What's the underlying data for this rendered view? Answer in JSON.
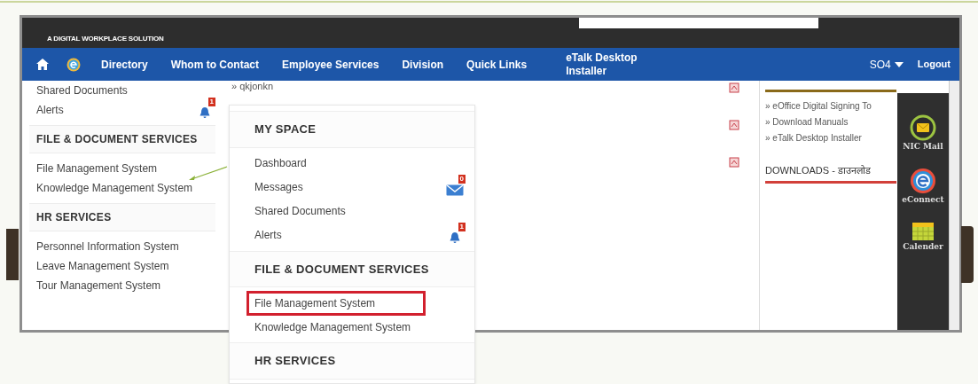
{
  "header": {
    "tagline": "A DIGITAL WORKPLACE SOLUTION"
  },
  "nav": {
    "items": [
      "Directory",
      "Whom to Contact",
      "Employee Services",
      "Division",
      "Quick Links",
      "eTalk Desktop Installer"
    ],
    "user": "SO4",
    "logout": "Logout"
  },
  "left_menu": [
    {
      "kind": "item",
      "label": "Shared Documents"
    },
    {
      "kind": "alert_item",
      "label": "Alerts",
      "badge": "1"
    },
    {
      "kind": "header",
      "label": "FILE & DOCUMENT SERVICES"
    },
    {
      "kind": "item",
      "label": "File Management System"
    },
    {
      "kind": "item",
      "label": "Knowledge Management System"
    },
    {
      "kind": "header",
      "label": "HR SERVICES"
    },
    {
      "kind": "item",
      "label": "Personnel Information System"
    },
    {
      "kind": "item",
      "label": "Leave Management System"
    },
    {
      "kind": "item",
      "label": "Tour Management System"
    }
  ],
  "main": {
    "link": "» qkjonkn"
  },
  "right_panel": {
    "links": [
      "» eOffice Digital Signing To",
      "» Download Manuals",
      "» eTalk Desktop Installer"
    ],
    "downloads_title": "DOWNLOADS - डाउनलोड"
  },
  "side_dock": [
    {
      "kind": "mail",
      "label": "NIC Mail"
    },
    {
      "kind": "econnect",
      "label": "eConnect"
    },
    {
      "kind": "calendar",
      "label": "Calender"
    }
  ],
  "zoom_menu": [
    {
      "kind": "header",
      "label": "MY SPACE",
      "highlighted": false
    },
    {
      "kind": "item",
      "label": "Dashboard",
      "highlighted": false
    },
    {
      "kind": "message_item",
      "label": "Messages",
      "badge": "0",
      "highlighted": false
    },
    {
      "kind": "item",
      "label": "Shared Documents",
      "highlighted": false
    },
    {
      "kind": "alert_item",
      "label": "Alerts",
      "badge": "1",
      "highlighted": false
    },
    {
      "kind": "header",
      "label": "FILE & DOCUMENT SERVICES",
      "highlighted": false
    },
    {
      "kind": "item",
      "label": "File Management System",
      "highlighted": true
    },
    {
      "kind": "item",
      "label": "Knowledge Management System",
      "highlighted": false
    },
    {
      "kind": "header",
      "label": "HR SERVICES",
      "highlighted": false
    }
  ]
}
